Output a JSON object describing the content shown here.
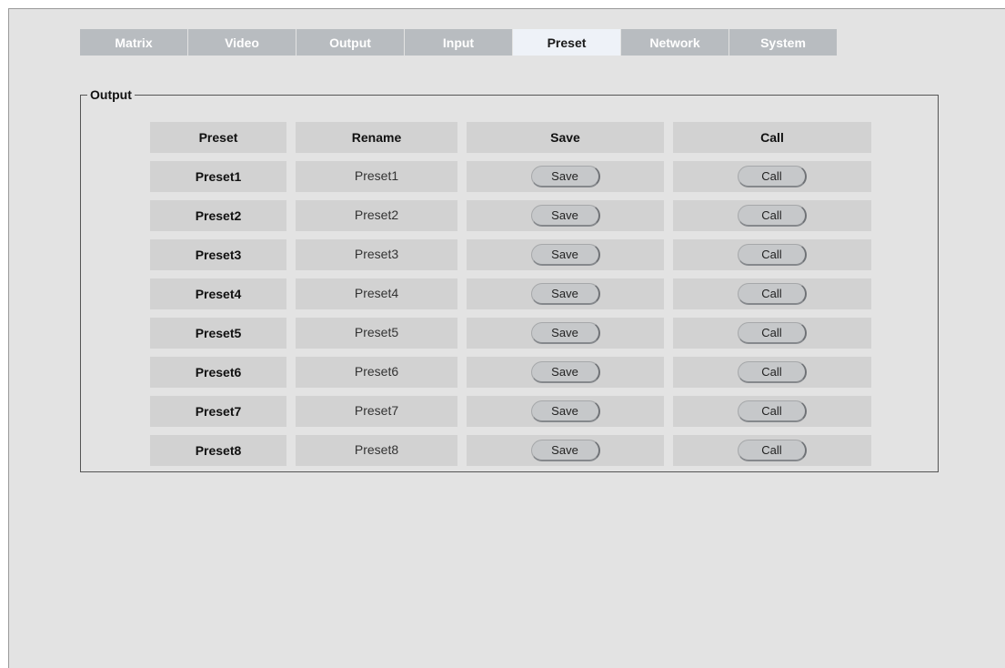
{
  "tabs": [
    "Matrix",
    "Video",
    "Output",
    "Input",
    "Preset",
    "Network",
    "System"
  ],
  "active_tab": "Preset",
  "group": {
    "legend": "Output"
  },
  "table": {
    "headers": {
      "preset": "Preset",
      "rename": "Rename",
      "save": "Save",
      "call": "Call"
    },
    "rows": [
      {
        "name": "Preset1",
        "rename": "Preset1",
        "save": "Save",
        "call": "Call"
      },
      {
        "name": "Preset2",
        "rename": "Preset2",
        "save": "Save",
        "call": "Call"
      },
      {
        "name": "Preset3",
        "rename": "Preset3",
        "save": "Save",
        "call": "Call"
      },
      {
        "name": "Preset4",
        "rename": "Preset4",
        "save": "Save",
        "call": "Call"
      },
      {
        "name": "Preset5",
        "rename": "Preset5",
        "save": "Save",
        "call": "Call"
      },
      {
        "name": "Preset6",
        "rename": "Preset6",
        "save": "Save",
        "call": "Call"
      },
      {
        "name": "Preset7",
        "rename": "Preset7",
        "save": "Save",
        "call": "Call"
      },
      {
        "name": "Preset8",
        "rename": "Preset8",
        "save": "Save",
        "call": "Call"
      }
    ]
  },
  "colors": {
    "tab_inactive": "#b8bcc0",
    "tab_active": "#eef2f8",
    "background": "#e3e3e3",
    "cell": "#d2d2d2"
  }
}
